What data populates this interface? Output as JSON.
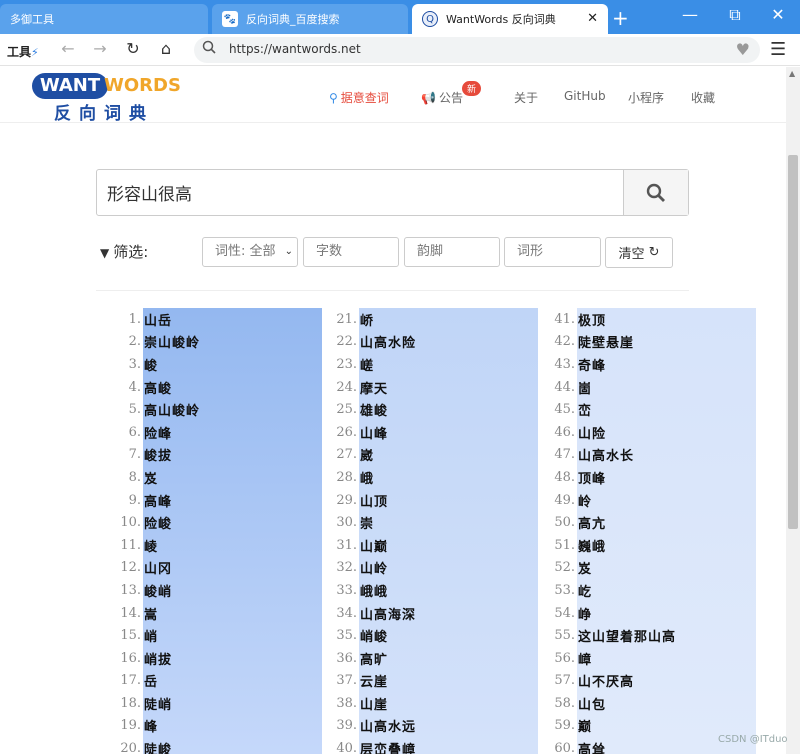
{
  "browser": {
    "tabs": [
      {
        "title": "多御工具",
        "active": false
      },
      {
        "title": "反向词典_百度搜索",
        "active": false
      },
      {
        "title": "WantWords 反向词典",
        "active": true
      }
    ],
    "tools_label": "工具",
    "url": "https://wantwords.net"
  },
  "site": {
    "logo_want": "WANT",
    "logo_words": "WORDS",
    "logo_cn": "反向词典",
    "nav": [
      "据意查词",
      "公告",
      "关于",
      "GitHub",
      "小程序",
      "收藏"
    ],
    "badge_new": "新"
  },
  "search": {
    "query": "形容山很高"
  },
  "filters": {
    "label": "筛选:",
    "pos_select": "词性: 全部",
    "char_count": "字数",
    "rhyme": "韵脚",
    "shape": "词形",
    "clear": "清空"
  },
  "results": {
    "col1": [
      "山岳",
      "崇山峻岭",
      "峻",
      "高峻",
      "高山峻岭",
      "险峰",
      "峻拔",
      "岌",
      "高峰",
      "险峻",
      "崚",
      "山冈",
      "峻峭",
      "嵩",
      "峭",
      "峭拔",
      "岳",
      "陡峭",
      "峰",
      "陡峻"
    ],
    "col2": [
      "峤",
      "山高水险",
      "嵯",
      "摩天",
      "雄峻",
      "山峰",
      "崴",
      "峨",
      "山顶",
      "崇",
      "山巅",
      "山岭",
      "峨峨",
      "山高海深",
      "峭峻",
      "高旷",
      "云崖",
      "山崖",
      "山高水远",
      "层峦叠嶂"
    ],
    "col3": [
      "极顶",
      "陡壁悬崖",
      "奇峰",
      "崮",
      "峦",
      "山险",
      "山高水长",
      "顶峰",
      "岭",
      "高亢",
      "巍峨",
      "岌",
      "屹",
      "峥",
      "这山望着那山高",
      "嶂",
      "山不厌高",
      "山包",
      "巅",
      "高耸"
    ]
  },
  "watermark": "CSDN @ITduo"
}
